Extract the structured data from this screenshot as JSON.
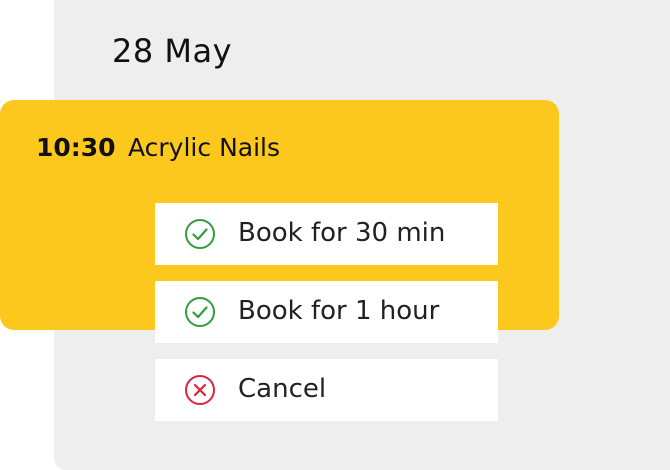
{
  "header": {
    "date": "28 May"
  },
  "booking": {
    "time": "10:30",
    "service": "Acrylic Nails"
  },
  "menu": {
    "items": [
      {
        "label": "Book for 30 min",
        "icon": "check-circle-icon"
      },
      {
        "label": "Book for 1 hour",
        "icon": "check-circle-icon"
      },
      {
        "label": "Cancel",
        "icon": "x-circle-icon"
      }
    ]
  },
  "colors": {
    "accent": "#fcc81d",
    "panel": "#eeeeee",
    "confirm": "#2e9e3e",
    "cancel": "#d9263c"
  }
}
